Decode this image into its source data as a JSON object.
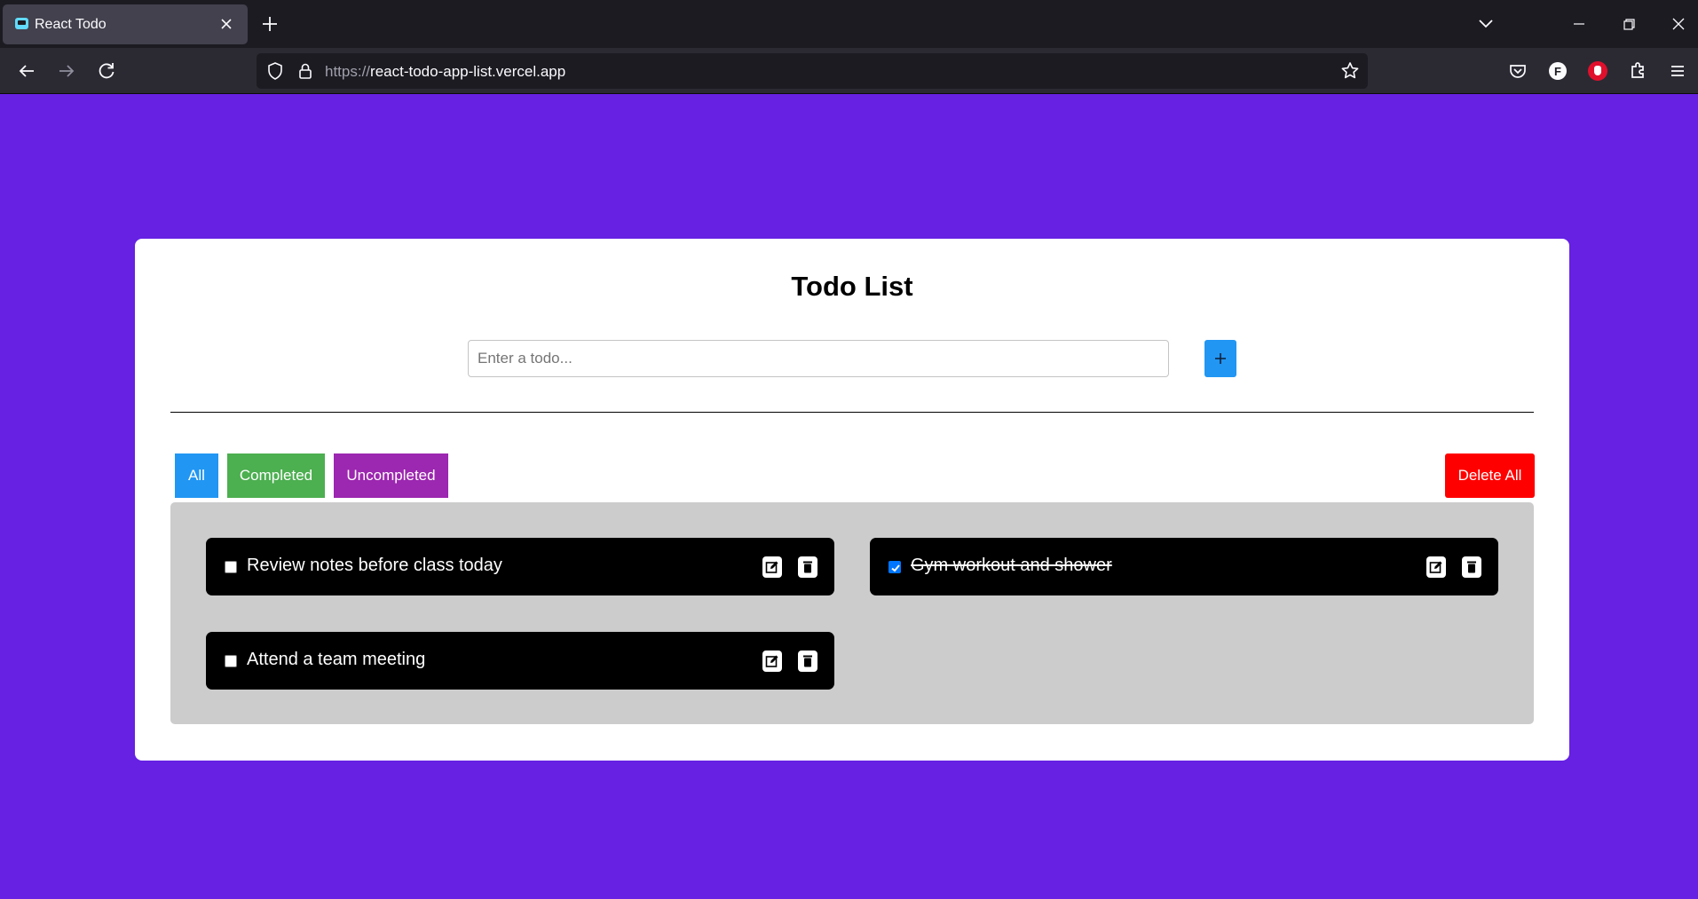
{
  "browser": {
    "tab_title": "React Todo",
    "url_scheme": "https://",
    "url_host": "react-todo-app-list.vercel.app",
    "extension_f_label": "F"
  },
  "app": {
    "title": "Todo List",
    "input_placeholder": "Enter a todo...",
    "input_value": "",
    "filters": {
      "all": "All",
      "completed": "Completed",
      "uncompleted": "Uncompleted"
    },
    "delete_all": "Delete All",
    "todos": [
      {
        "text": "Review notes before class today",
        "completed": false
      },
      {
        "text": "Gym workout and shower",
        "completed": true
      },
      {
        "text": "Attend a team meeting",
        "completed": false
      }
    ]
  },
  "colors": {
    "page_background": "#6621e3",
    "add_button": "#2196f3",
    "filter_all": "#2196f3",
    "filter_completed": "#4caf50",
    "filter_uncompleted": "#9c27b0",
    "delete_all": "#ff0000",
    "list_background": "#cccccc",
    "todo_item": "#000000"
  }
}
